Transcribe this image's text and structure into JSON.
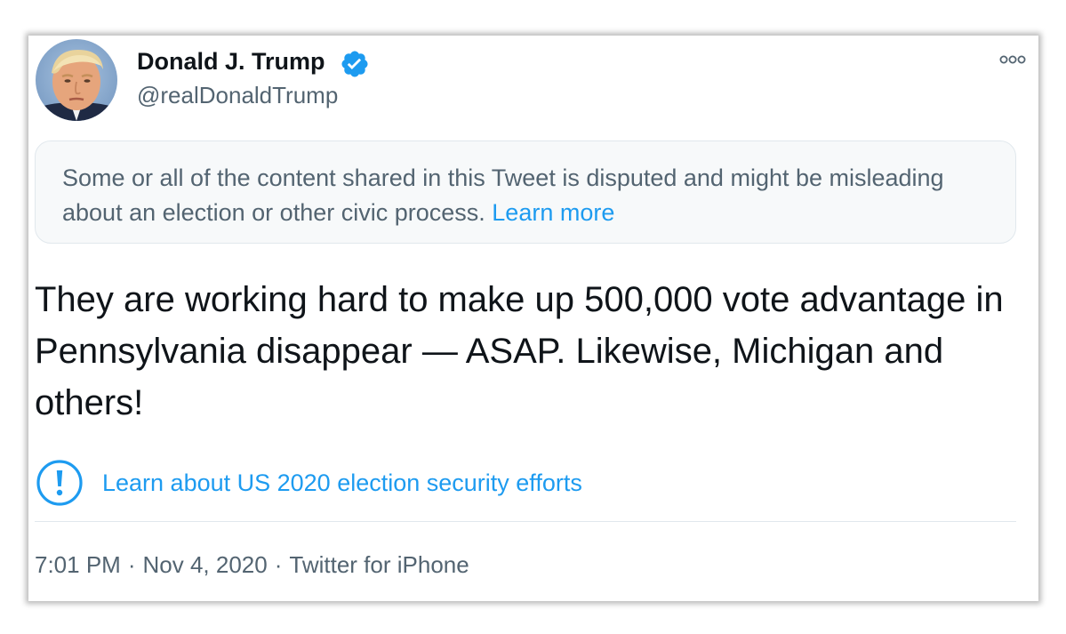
{
  "author": {
    "name": "Donald J. Trump",
    "handle": "@realDonaldTrump",
    "avatar_icon": "profile-photo",
    "verified_icon": "verified-badge-icon"
  },
  "notice": {
    "text": "Some or all of the content shared in this Tweet is disputed and might be misleading about an election or other civic process.",
    "link": "Learn more"
  },
  "tweet": {
    "text": "They are working hard to make up 500,000 vote advantage in Pennsylvania disappear — ASAP. Likewise, Michigan and others!"
  },
  "election_notice": {
    "icon": "exclamation-circle-icon",
    "text": "Learn about US 2020 election security efforts"
  },
  "meta": {
    "time": "7:01 PM",
    "separator": "·",
    "date": "Nov 4, 2020",
    "source": "Twitter for iPhone"
  },
  "more_menu_icon": "more-options-icon",
  "colors": {
    "link": "#1d9bf0",
    "text": "#0f1419",
    "secondary": "#536471",
    "notice_bg": "#f7f9fa"
  }
}
